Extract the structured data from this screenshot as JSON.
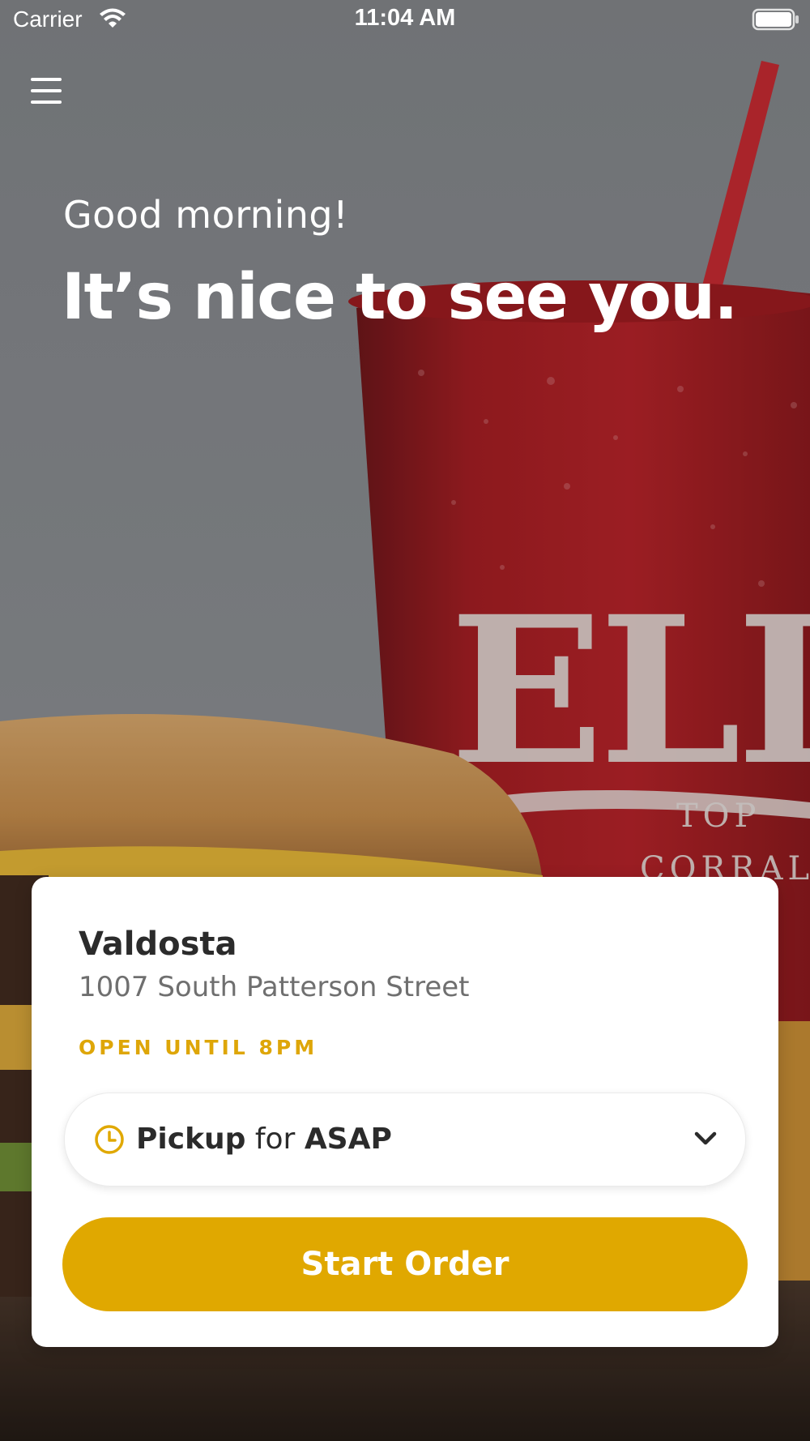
{
  "status_bar": {
    "carrier": "Carrier",
    "time": "11:04 AM",
    "wifi_icon": "wifi-icon",
    "battery_icon": "battery-icon"
  },
  "header": {
    "menu_icon": "hamburger-menu-icon"
  },
  "greeting": {
    "salutation": "Good morning!",
    "headline": "It’s nice to see you."
  },
  "hero": {
    "cup_lettering": "ELLA",
    "cup_sub_lettering": "TOP CORRAL"
  },
  "store": {
    "name": "Valdosta",
    "address": "1007 South Patterson Street",
    "hours": "OPEN UNTIL 8PM"
  },
  "order_mode": {
    "icon": "clock-icon",
    "mode": "Pickup",
    "connector": "for",
    "time": "ASAP",
    "dropdown_icon": "chevron-down-icon"
  },
  "actions": {
    "start_order_label": "Start Order"
  },
  "colors": {
    "accent": "#e0a800",
    "hours_text": "#dea608",
    "card_bg": "#ffffff"
  }
}
